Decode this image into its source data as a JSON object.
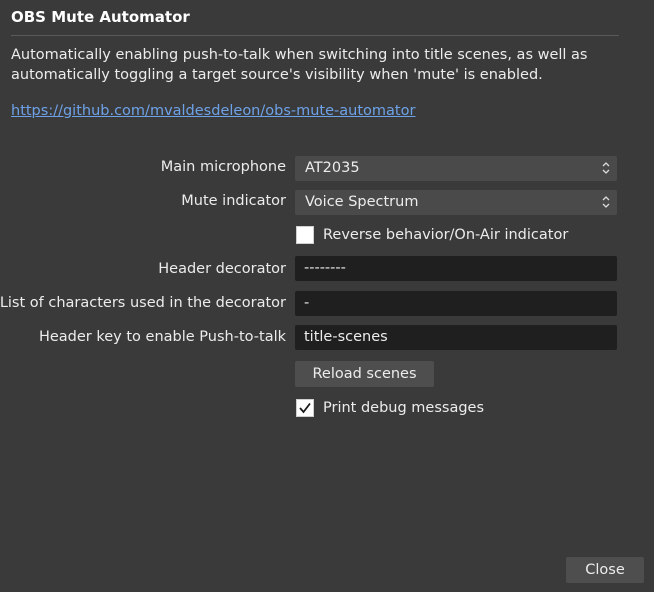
{
  "dialog": {
    "title": "OBS Mute Automator",
    "description": "Automatically enabling push-to-talk when switching into title scenes, as well as automatically toggling a target source's visibility when 'mute' is enabled.",
    "link": "https://github.com/mvaldesdeleon/obs-mute-automator"
  },
  "form": {
    "main_microphone": {
      "label": "Main microphone",
      "value": "AT2035"
    },
    "mute_indicator": {
      "label": "Mute indicator",
      "value": "Voice Spectrum"
    },
    "reverse_behavior": {
      "label": "Reverse behavior/On-Air indicator",
      "checked": false
    },
    "header_decorator": {
      "label": "Header decorator",
      "value": "--------"
    },
    "decorator_chars": {
      "label": "List of characters used in the decorator",
      "value": "-"
    },
    "header_key": {
      "label": "Header key to enable Push-to-talk",
      "value": "title-scenes"
    },
    "reload_button": {
      "label": "Reload scenes"
    },
    "print_debug": {
      "label": "Print debug messages",
      "checked": true
    }
  },
  "footer": {
    "close_label": "Close"
  },
  "icons": {
    "select_arrows": "updown-chevron-icon",
    "checkmark": "checkmark-icon"
  },
  "colors": {
    "background": "#3a3a3a",
    "link": "#6ea2e8",
    "input_bg": "#1f1f1f",
    "select_bg": "#4a4a4a",
    "button_bg": "#4e4e4e"
  }
}
